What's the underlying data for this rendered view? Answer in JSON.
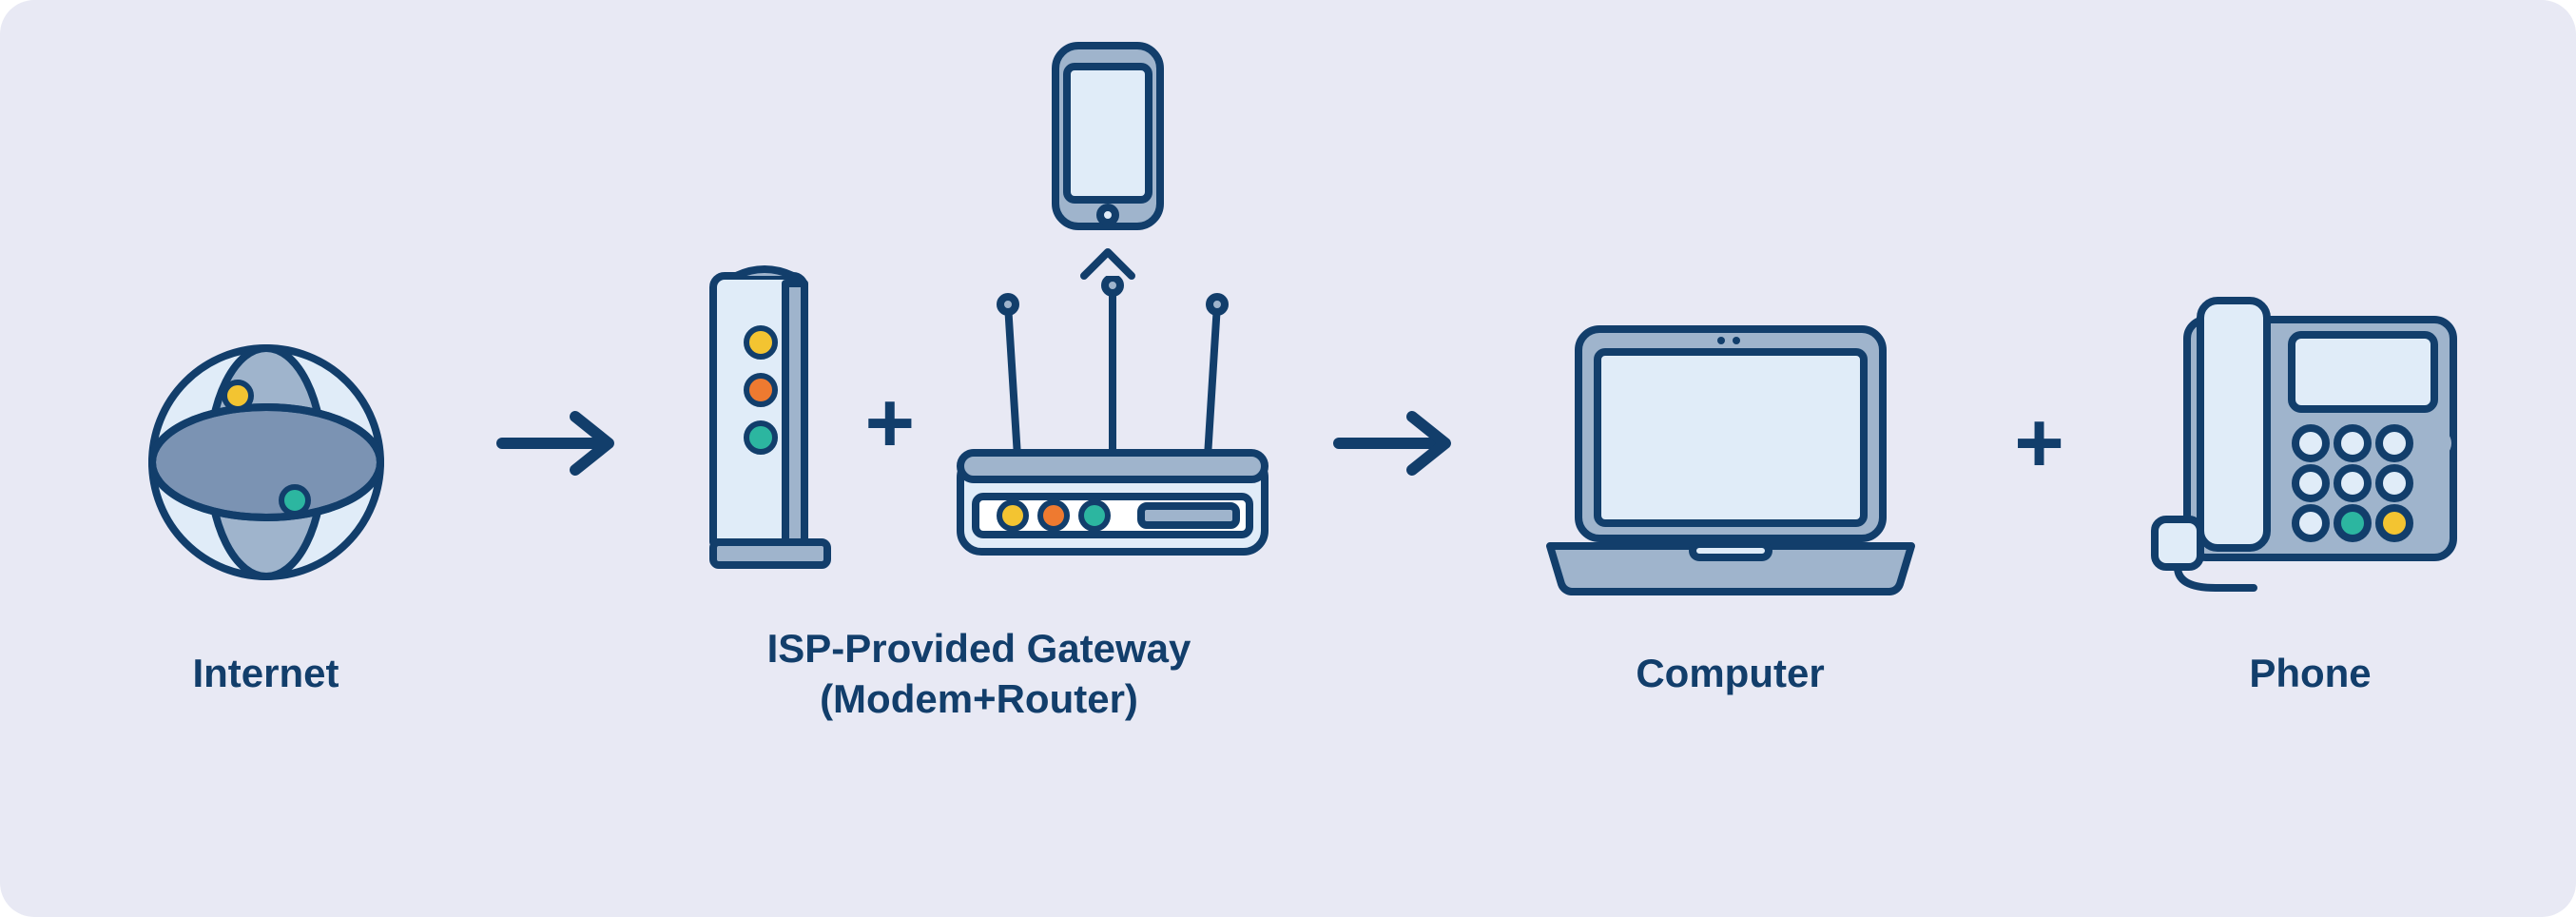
{
  "diagram": {
    "nodes": {
      "internet": {
        "label": "Internet",
        "icon": "globe-icon"
      },
      "gateway": {
        "label": "ISP-Provided Gateway\n(Modem+Router)",
        "icons": [
          "modem-icon",
          "router-icon",
          "smartphone-icon"
        ]
      },
      "computer": {
        "label": "Computer",
        "icon": "laptop-icon"
      },
      "phone": {
        "label": "Phone",
        "icon": "deskphone-icon"
      }
    },
    "connectors": [
      "arrow",
      "plus",
      "arrow",
      "plus"
    ],
    "flow": [
      "internet",
      "arrow",
      "gateway",
      "arrow",
      "computer",
      "plus",
      "phone"
    ],
    "colors": {
      "stroke": "#123e6b",
      "fill_body": "#9fb4cc",
      "fill_light": "#e0ecf8",
      "bg": "#e8e9f4",
      "yellow": "#f3c431",
      "orange": "#ee7a30",
      "green": "#2cb6a0"
    }
  }
}
